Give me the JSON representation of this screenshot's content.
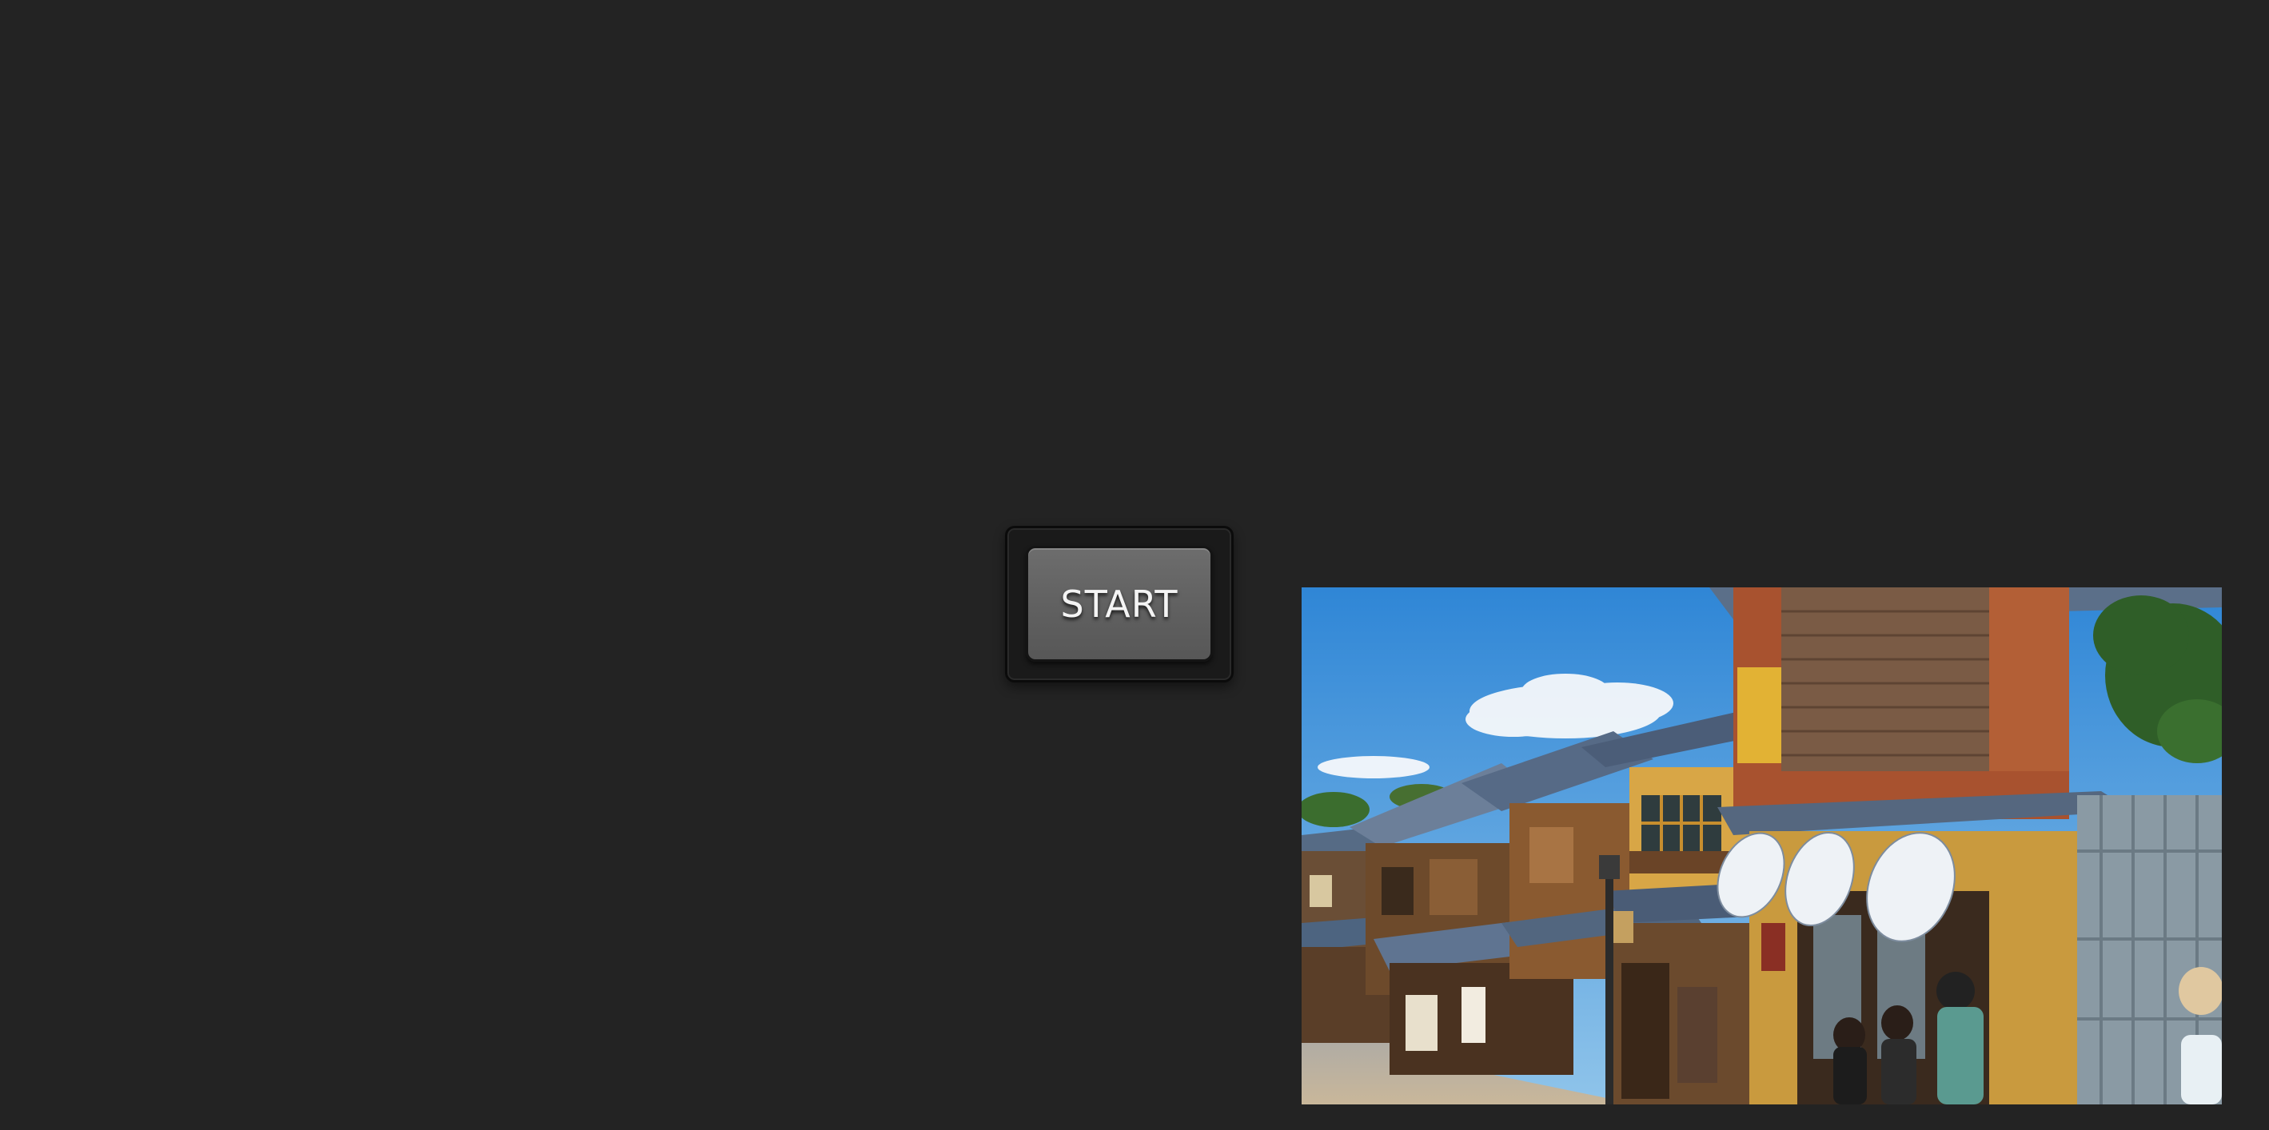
{
  "start_button": {
    "label": "START"
  },
  "scene_image": {
    "subject": "street-scene-image"
  },
  "colors": {
    "background": "#232323",
    "button_face": "#606060",
    "button_frame": "#1a1a1a",
    "sky": "#4f9bd8"
  }
}
